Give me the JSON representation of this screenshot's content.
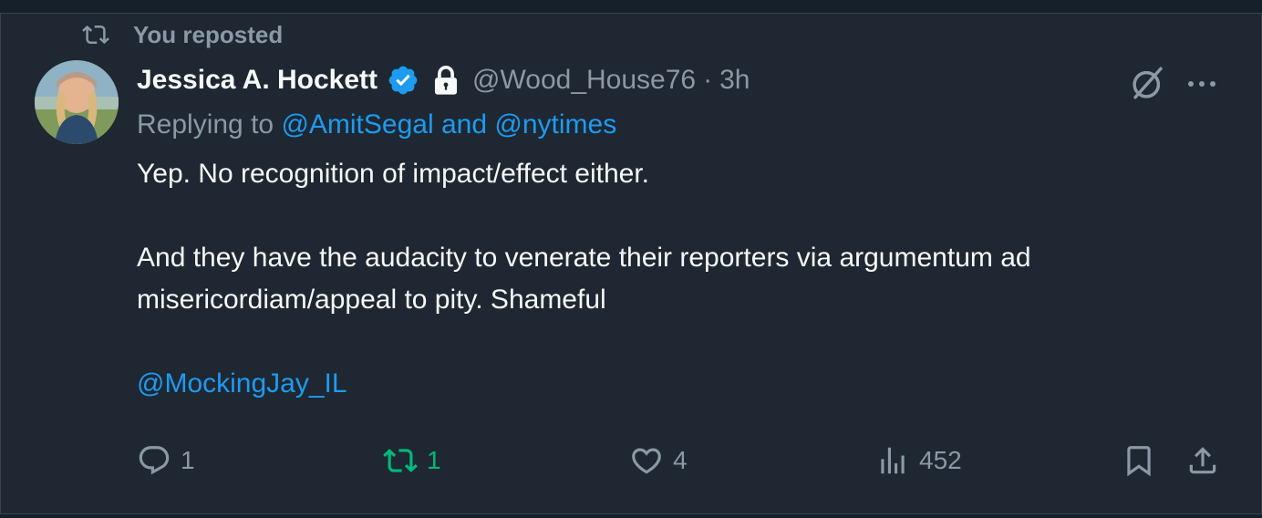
{
  "repost": {
    "label": "You reposted"
  },
  "author": {
    "name": "Jessica A. Hockett",
    "handle": "@Wood_House76",
    "separator": "·",
    "time": "3h"
  },
  "reply": {
    "prefix": "Replying to",
    "mention1": "@AmitSegal",
    "conj": "and",
    "mention2": "@nytimes"
  },
  "body": {
    "line1": "Yep. No recognition of impact/effect either.",
    "line2": "And they have the audacity to venerate their reporters via argumentum ad misericordiam/appeal to pity. Shameful",
    "mention": "@MockingJay_IL"
  },
  "actions": {
    "replies": "1",
    "reposts": "1",
    "likes": "4",
    "views": "452"
  },
  "icons": {
    "repost": "repost-icon",
    "verified": "verified-badge-icon",
    "lock": "lock-icon",
    "grok": "grok-icon",
    "more": "more-icon",
    "reply": "reply-icon",
    "like": "heart-icon",
    "views": "views-icon",
    "bookmark": "bookmark-icon",
    "share": "share-icon"
  },
  "colors": {
    "background": "#1e2732",
    "text": "#f7f9f9",
    "muted": "#8b98a5",
    "link": "#1d9bf0",
    "repost_active": "#00ba7c"
  }
}
